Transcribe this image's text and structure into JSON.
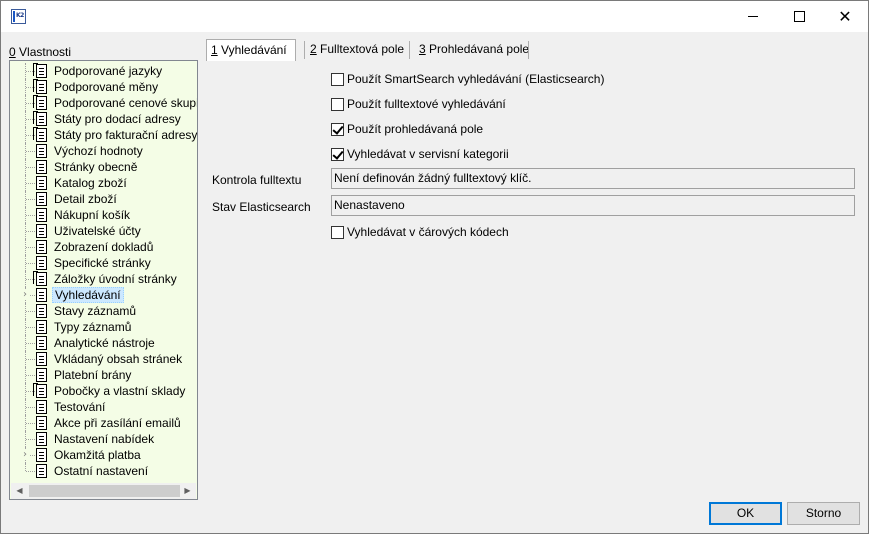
{
  "window": {
    "app_icon_text": "K2"
  },
  "left_panel": {
    "label_accel": "0",
    "label_rest": " Vlastnosti",
    "tree_items": [
      {
        "label": "Podporované jazyky",
        "icon": "multi-document-icon"
      },
      {
        "label": "Podporované měny",
        "icon": "multi-document-icon"
      },
      {
        "label": "Podporované cenové skupiny",
        "icon": "multi-document-icon"
      },
      {
        "label": "Státy pro dodací adresy",
        "icon": "multi-document-icon"
      },
      {
        "label": "Státy pro fakturační adresy",
        "icon": "multi-document-icon"
      },
      {
        "label": "Výchozí hodnoty",
        "icon": "document-icon"
      },
      {
        "label": "Stránky obecně",
        "icon": "document-icon"
      },
      {
        "label": "Katalog zboží",
        "icon": "document-icon"
      },
      {
        "label": "Detail zboží",
        "icon": "document-icon"
      },
      {
        "label": "Nákupní košík",
        "icon": "document-icon"
      },
      {
        "label": "Uživatelské účty",
        "icon": "document-icon"
      },
      {
        "label": "Zobrazení dokladů",
        "icon": "document-icon"
      },
      {
        "label": "Specifické stránky",
        "icon": "document-icon"
      },
      {
        "label": "Záložky úvodní stránky",
        "icon": "multi-document-icon"
      },
      {
        "label": "Vyhledávání",
        "icon": "document-icon",
        "selected": true,
        "expandable": true
      },
      {
        "label": "Stavy záznamů",
        "icon": "document-icon"
      },
      {
        "label": "Typy záznamů",
        "icon": "document-icon"
      },
      {
        "label": "Analytické nástroje",
        "icon": "document-icon"
      },
      {
        "label": "Vkládaný obsah stránek",
        "icon": "document-icon"
      },
      {
        "label": "Platební brány",
        "icon": "document-icon"
      },
      {
        "label": "Pobočky a vlastní sklady",
        "icon": "multi-document-icon"
      },
      {
        "label": "Testování",
        "icon": "document-icon"
      },
      {
        "label": "Akce při zasílání emailů",
        "icon": "document-icon"
      },
      {
        "label": "Nastavení nabídek",
        "icon": "document-icon"
      },
      {
        "label": "Okamžitá platba",
        "icon": "document-icon",
        "expandable": true
      },
      {
        "label": "Ostatní nastavení",
        "icon": "document-icon",
        "last": true
      }
    ]
  },
  "tabs": [
    {
      "accel": "1",
      "rest": " Vyhledávání",
      "active": true
    },
    {
      "accel": "2",
      "rest": " Fulltextová pole",
      "active": false
    },
    {
      "accel": "3",
      "rest": " Prohledávaná pole",
      "active": false
    }
  ],
  "options": {
    "smartsearch": {
      "label": "Použít SmartSearch vyhledávání (Elasticsearch)",
      "checked": false
    },
    "fulltext": {
      "label": "Použít fulltextové vyhledávání",
      "checked": false
    },
    "searched_fields": {
      "label": "Použít prohledávaná pole",
      "checked": true
    },
    "service_category": {
      "label": "Vyhledávat v servisní kategorii",
      "checked": true
    },
    "barcodes": {
      "label": "Vyhledávat v čárových kódech",
      "checked": false
    }
  },
  "fields": {
    "fulltext_control": {
      "label": "Kontrola fulltextu",
      "value": "Není definován žádný fulltextový klíč."
    },
    "elastic_state": {
      "label": "Stav Elasticsearch",
      "value": "Nenastaveno"
    }
  },
  "buttons": {
    "ok": "OK",
    "cancel": "Storno"
  }
}
